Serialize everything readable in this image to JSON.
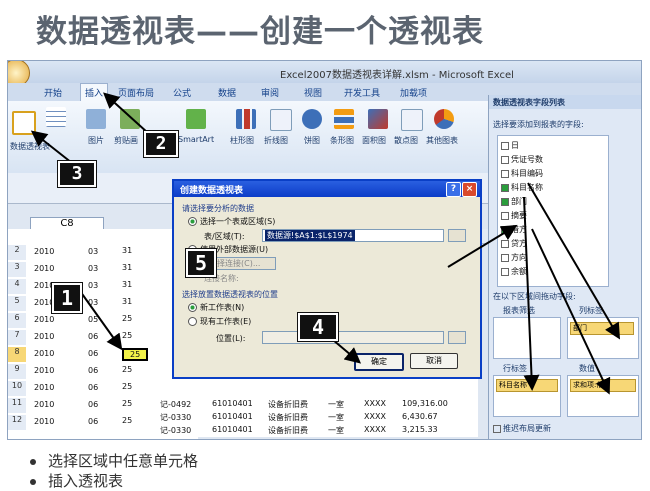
{
  "slide": {
    "title": "数据透视表——创建一个透视表",
    "bullets": [
      "选择区域中任意单元格",
      "插入透视表"
    ]
  },
  "excel": {
    "window_title": "Excel2007数据透视表详解.xlsm - Microsoft Excel",
    "tabs": [
      "开始",
      "插入",
      "页面布局",
      "公式",
      "数据",
      "审阅",
      "视图",
      "开发工具",
      "加载项"
    ],
    "active_tab": "插入",
    "ribbon": {
      "pivot_label": "数据透视表",
      "items": [
        "图片",
        "剪贴画",
        "SmartArt",
        "柱形图",
        "折线图",
        "饼图",
        "条形图",
        "面积图",
        "散点图",
        "其他图表"
      ]
    },
    "name_box": "C8",
    "columns": [
      "A",
      "B",
      "C",
      "D"
    ],
    "rows": [
      {
        "n": "2",
        "a": "2010",
        "b": "03",
        "c": "31"
      },
      {
        "n": "3",
        "a": "2010",
        "b": "03",
        "c": "31"
      },
      {
        "n": "4",
        "a": "2010",
        "b": "03",
        "c": "31"
      },
      {
        "n": "5",
        "a": "2010",
        "b": "03",
        "c": "31"
      },
      {
        "n": "6",
        "a": "2010",
        "b": "05",
        "c": "25"
      },
      {
        "n": "7",
        "a": "2010",
        "b": "06",
        "c": "25"
      },
      {
        "n": "8",
        "a": "2010",
        "b": "06",
        "c": "25"
      },
      {
        "n": "9",
        "a": "2010",
        "b": "06",
        "c": "25"
      },
      {
        "n": "10",
        "a": "2010",
        "b": "06",
        "c": "25"
      },
      {
        "n": "11",
        "a": "2010",
        "b": "06",
        "c": "25"
      },
      {
        "n": "12",
        "a": "2010",
        "b": "06",
        "c": "25"
      }
    ],
    "bottom_rows": [
      {
        "code": "记-0492",
        "acct": "61010401",
        "name": "设备折旧费",
        "dept": "一室",
        "x": "XXXX",
        "amt": "109,316.00"
      },
      {
        "code": "记-0330",
        "acct": "61010401",
        "name": "设备折旧费",
        "dept": "一室",
        "x": "XXXX",
        "amt": "6,430.67"
      },
      {
        "code": "记-0330",
        "acct": "61010401",
        "name": "设备折旧费",
        "dept": "一室",
        "x": "XXXX",
        "amt": "3,215.33"
      }
    ]
  },
  "dialog": {
    "title": "创建数据透视表",
    "section1": "请选择要分析的数据",
    "opt_table": "选择一个表或区域(S)",
    "range_label": "表/区域(T):",
    "range_value": "数据源!$A$1:$L$1974",
    "opt_external": "使用外部数据源(U)",
    "choose_conn": "选择连接(C)...",
    "conn_name": "连接名称:",
    "section2": "选择放置数据透视表的位置",
    "opt_new": "新工作表(N)",
    "opt_existing": "现有工作表(E)",
    "location_label": "位置(L):",
    "ok": "确定",
    "cancel": "取消"
  },
  "fieldlist": {
    "title": "数据透视表字段列表",
    "prompt": "选择要添加到报表的字段:",
    "fields": [
      {
        "label": "日",
        "checked": false
      },
      {
        "label": "凭证号数",
        "checked": false
      },
      {
        "label": "科目编码",
        "checked": false
      },
      {
        "label": "科目名称",
        "checked": true
      },
      {
        "label": "部门",
        "checked": true
      },
      {
        "label": "摘要",
        "checked": false
      },
      {
        "label": "借方",
        "checked": true
      },
      {
        "label": "贷方",
        "checked": false
      },
      {
        "label": "方向",
        "checked": false
      },
      {
        "label": "余额",
        "checked": false
      }
    ],
    "drag_prompt": "在以下区域间拖动字段:",
    "report_filter": "报表筛选",
    "column_labels": "列标签",
    "col_chip": "部门",
    "row_labels": "行标签",
    "row_chip": "科目名称",
    "values": "数值",
    "val_chip": "求和项:借方",
    "defer": "推迟布局更新"
  },
  "steps": [
    "1",
    "2",
    "3",
    "4",
    "5"
  ]
}
